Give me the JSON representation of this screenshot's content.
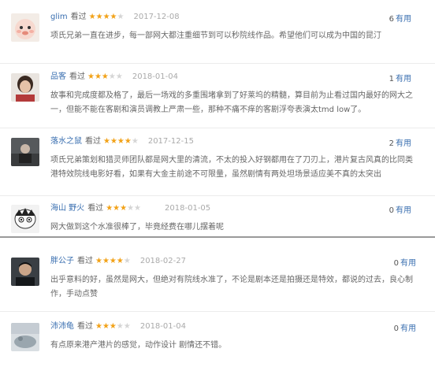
{
  "reviews": [
    {
      "user": "glim",
      "status": "看过",
      "stars": 4,
      "date": "2017-12-08",
      "useful_count": "6",
      "useful_label": "有用",
      "text": "项氏兄弟一直在进步，每一部网大都注重细节到可以秒院线作品。希望他们可以成为中国的昆汀"
    },
    {
      "user": "品客",
      "status": "看过",
      "stars": 3,
      "date": "2018-01-04",
      "useful_count": "1",
      "useful_label": "有用",
      "text": "故事和完成度都及格了，最后一场戏的多重围堵拿到了好莱坞的精髓，算目前为止看过国内最好的网大之一，但能不能在客剧和演员调教上严肃一些，那种不痛不痒的客剧浮夸表演太tmd low了。"
    },
    {
      "user": "落水之鼠",
      "status": "看过",
      "stars": 4,
      "date": "2017-12-15",
      "useful_count": "2",
      "useful_label": "有用",
      "text": "项氏兄弟策划和猎灵师团队都是网大里的清流，不太的投入好钢都用在了刀刃上，港片复古风真的比同类港特效院线电影好看，如果有大金主前途不可限量，虽然剧情有两处坦场景适应美不真的太突出"
    },
    {
      "user": "海山 野火",
      "status": "看过",
      "stars": 3,
      "date": "2018-01-05",
      "useful_count": "0",
      "useful_label": "有用",
      "text": "网大做到这个水准很棒了，毕竟经费在哪儿摆着呢"
    },
    {
      "user": "胖公子",
      "status": "看过",
      "stars": 4,
      "date": "2018-02-27",
      "useful_count": "0",
      "useful_label": "有用",
      "text": "出乎意料的好，虽然是网大，但绝对有院线水准了，不论是剧本还是拍摄还是特效，都说的过去，良心制作，手动点赞"
    },
    {
      "user": "沛沛龟",
      "status": "看过",
      "stars": 3,
      "date": "2018-01-04",
      "useful_count": "0",
      "useful_label": "有用",
      "text": "有点原来港产港片的感觉，动作设计 剧情还不错。"
    }
  ]
}
